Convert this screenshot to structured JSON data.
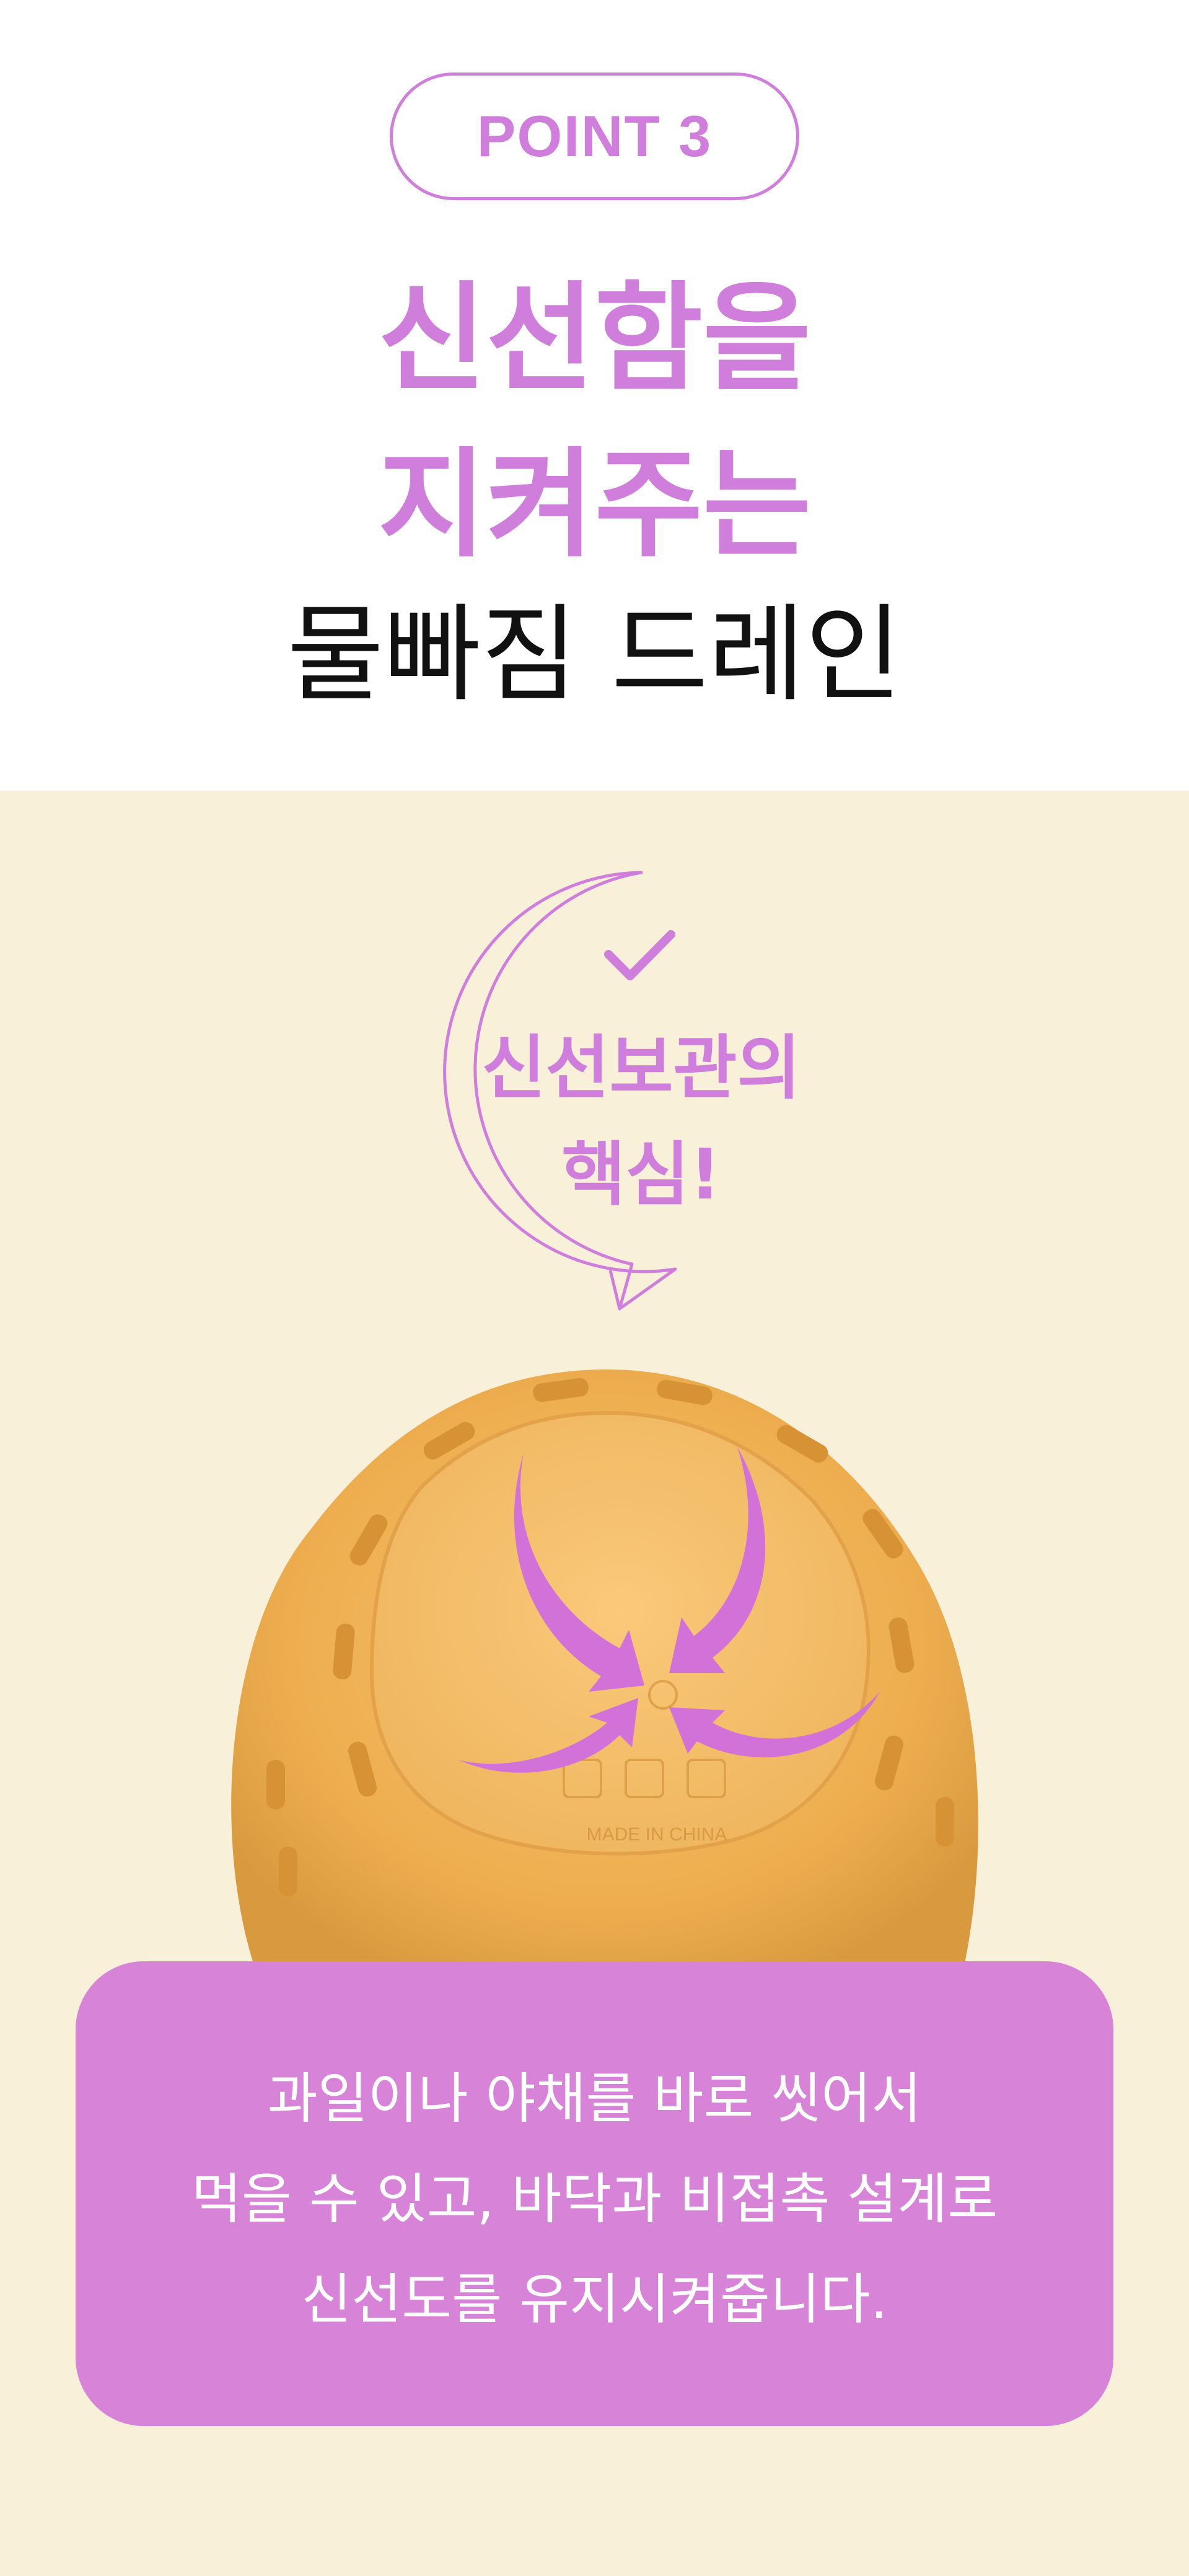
{
  "badge": {
    "label": "POINT 3"
  },
  "headline": {
    "line1": "신선함을",
    "line2": "지켜주는",
    "line3": "물빠짐 드레인"
  },
  "bubble": {
    "icon": "check-icon",
    "line1": "신선보관의",
    "line2": "핵심!"
  },
  "product": {
    "embossed_text": "MADE IN CHINA",
    "icons": [
      "drain-arrows-icon",
      "fork-knife-icon",
      "snowflake-icon",
      "recycle-icon"
    ]
  },
  "info": {
    "line1": "과일이나 야채를 바로 씻어서",
    "line2": "먹을 수 있고, 바닥과 비접촉 설계로",
    "line3": "신선도를 유지시켜줍니다."
  },
  "colors": {
    "accent": "#cf7fdb",
    "background_lower": "#f8f0d9",
    "product": "#f0b55a",
    "info_box": "#d784d8"
  }
}
